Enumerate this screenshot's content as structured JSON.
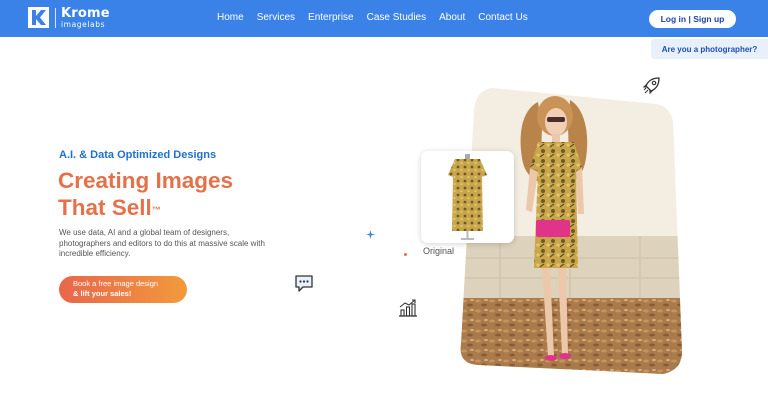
{
  "brand": {
    "name": "Krome",
    "sub": "imagelabs"
  },
  "nav": {
    "items": [
      {
        "label": "Home"
      },
      {
        "label": "Services"
      },
      {
        "label": "Enterprise"
      },
      {
        "label": "Case Studies"
      },
      {
        "label": "About"
      },
      {
        "label": "Contact Us"
      }
    ],
    "login_label": "Log in | Sign up"
  },
  "photographer_button": "Are you a photographer?",
  "hero": {
    "tagline": "A.I. & Data Optimized Designs",
    "headline_line1": "Creating Images",
    "headline_line2": "That Sell",
    "trademark": "™",
    "description": "We use data, AI and a global team of designers, photographers and editors to do this at massive scale with incredible efficiency.",
    "cta_line1": "Book a free image design",
    "cta_line2": "& lift your sales!"
  },
  "showcase": {
    "original_label": "Original"
  },
  "icons": {
    "logo": "krome-logo-icon",
    "rocket": "rocket-icon",
    "sparkle": "sparkle-icon",
    "chat": "chat-bubble-icon",
    "chart": "growth-chart-icon"
  },
  "colors": {
    "header_bg": "#3b82e8",
    "tagline": "#1f6fd1",
    "headline": "#e4714a",
    "cta_start": "#e8664b",
    "cta_end": "#f29a3c"
  }
}
